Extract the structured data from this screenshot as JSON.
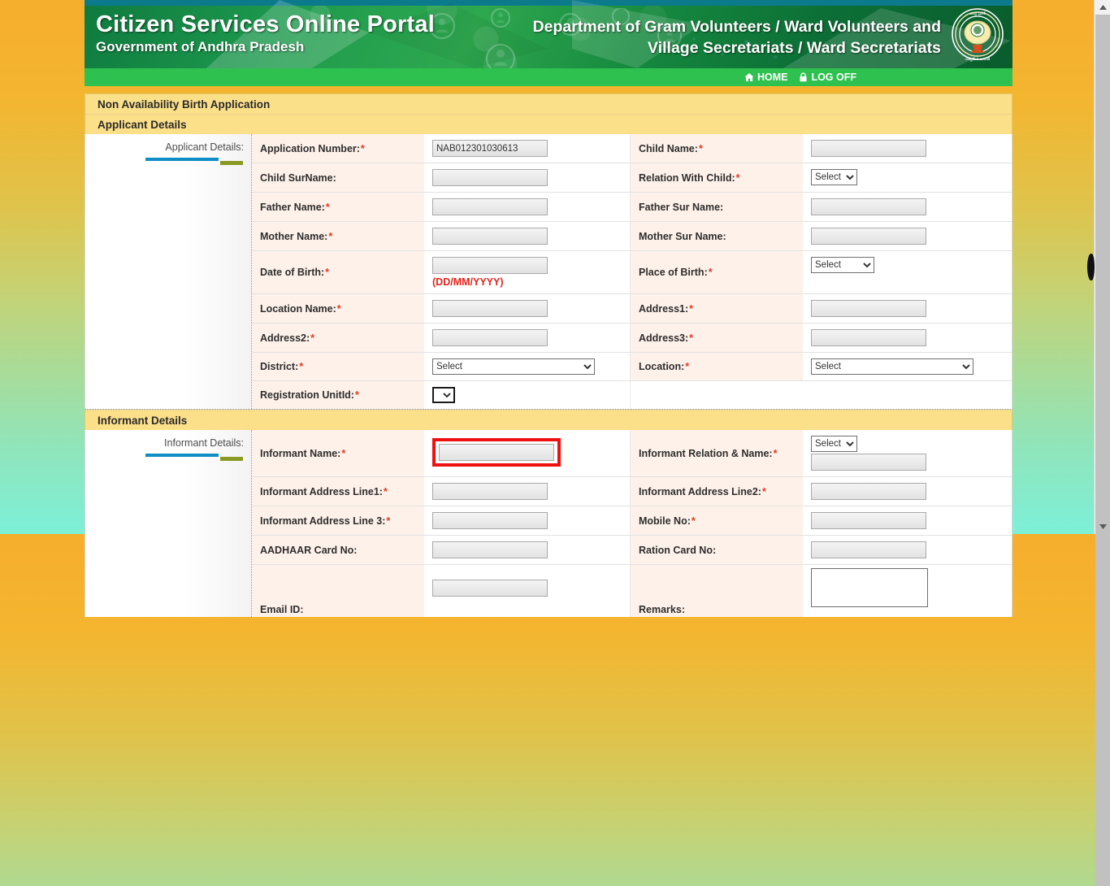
{
  "header": {
    "brand_line1": "Citizen Services Online Portal",
    "brand_line2": "Government of Andhra Pradesh",
    "dept_line1": "Department of Gram Volunteers / Ward Volunteers and",
    "dept_line2": "Village Secretariats / Ward Secretariats",
    "emblem_name": "andhra-pradesh-emblem"
  },
  "nav": {
    "home_label": "HOME",
    "logoff_label": "LOG OFF"
  },
  "form": {
    "page_title": "Non Availability Birth Application",
    "applicant_section_title": "Applicant Details",
    "applicant_side_label": "Applicant Details:",
    "informant_section_title": "Informant Details",
    "informant_side_label": "Informant Details:",
    "select_placeholder": "Select",
    "dob_hint": "(DD/MM/YYYY)"
  },
  "applicant": {
    "rows": [
      {
        "left": {
          "label": "Application Number:",
          "required": true,
          "type": "text",
          "value": "NAB012301030613"
        },
        "right": {
          "label": "Child Name:",
          "required": true,
          "type": "text",
          "value": ""
        }
      },
      {
        "left": {
          "label": "Child SurName:",
          "required": false,
          "type": "text",
          "value": ""
        },
        "right": {
          "label": "Relation With Child:",
          "required": true,
          "type": "select",
          "value": "Select"
        }
      },
      {
        "left": {
          "label": "Father Name:",
          "required": true,
          "type": "text",
          "value": ""
        },
        "right": {
          "label": "Father Sur Name:",
          "required": false,
          "type": "text",
          "value": ""
        }
      },
      {
        "left": {
          "label": "Mother Name:",
          "required": true,
          "type": "text",
          "value": ""
        },
        "right": {
          "label": "Mother Sur Name:",
          "required": false,
          "type": "text",
          "value": ""
        }
      },
      {
        "left": {
          "label": "Date of Birth:",
          "required": true,
          "type": "text-hint",
          "value": "",
          "hint": "(DD/MM/YYYY)"
        },
        "right": {
          "label": "Place of Birth:",
          "required": true,
          "type": "select",
          "value": "Select"
        }
      },
      {
        "left": {
          "label": "Location Name:",
          "required": true,
          "type": "text",
          "value": ""
        },
        "right": {
          "label": "Address1:",
          "required": true,
          "type": "text",
          "value": ""
        }
      },
      {
        "left": {
          "label": "Address2:",
          "required": true,
          "type": "text",
          "value": ""
        },
        "right": {
          "label": "Address3:",
          "required": true,
          "type": "text",
          "value": ""
        }
      },
      {
        "left": {
          "label": "District:",
          "required": true,
          "type": "select-wide",
          "value": "Select"
        },
        "right": {
          "label": "Location:",
          "required": true,
          "type": "select-wide",
          "value": "Select"
        }
      },
      {
        "left": {
          "label": "Registration UnitId:",
          "required": true,
          "type": "select-tiny",
          "value": ""
        },
        "right": {
          "label": "",
          "required": false,
          "type": "empty",
          "value": ""
        }
      }
    ]
  },
  "informant": {
    "rows": [
      {
        "left": {
          "label": "Informant Name:",
          "required": true,
          "type": "text-highlight",
          "value": ""
        },
        "right": {
          "label": "Informant Relation & Name:",
          "required": true,
          "type": "select-plus-text",
          "value": "Select",
          "value2": ""
        }
      },
      {
        "left": {
          "label": "Informant Address Line1:",
          "required": true,
          "type": "text",
          "value": ""
        },
        "right": {
          "label": "Informant Address Line2:",
          "required": true,
          "type": "text",
          "value": ""
        }
      },
      {
        "left": {
          "label": "Informant Address Line 3:",
          "required": true,
          "type": "text",
          "value": ""
        },
        "right": {
          "label": "Mobile No:",
          "required": true,
          "type": "text",
          "value": ""
        }
      },
      {
        "left": {
          "label": "AADHAAR Card No:",
          "required": false,
          "type": "text",
          "value": ""
        },
        "right": {
          "label": "Ration Card No:",
          "required": false,
          "type": "text",
          "value": ""
        }
      },
      {
        "left": {
          "label": "Email ID:",
          "required": false,
          "type": "text",
          "value": ""
        },
        "right": {
          "label": "Remarks:",
          "required": false,
          "type": "textarea",
          "value": ""
        }
      }
    ]
  },
  "colors": {
    "banner_green": "#16893f",
    "nav_green": "#2fc14f",
    "panel_yellow": "#fbe08a",
    "label_peach": "#fdf1e9",
    "required_red": "#e03a20",
    "highlight_red": "#ee1111",
    "side_bar_blue": "#0f8ec4",
    "side_bar_olive": "#8a9b24"
  }
}
